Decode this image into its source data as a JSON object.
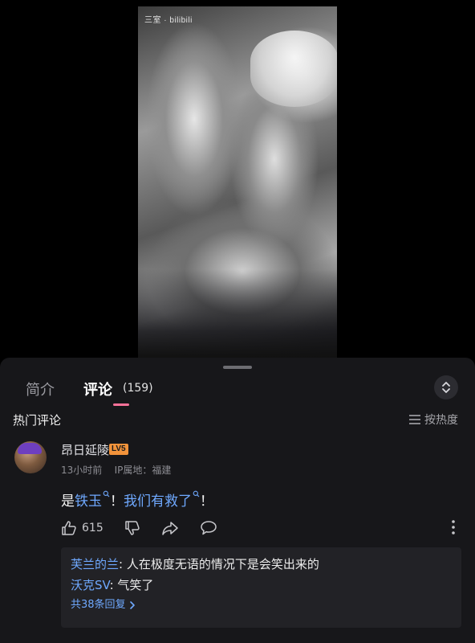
{
  "video": {
    "watermark": "三室 · bilibili"
  },
  "tabs": [
    {
      "label": "简介"
    },
    {
      "label": "评论",
      "count": "(159)",
      "active": true
    }
  ],
  "accent_color": "#fb7299",
  "link_color": "#6fa9ff",
  "section": {
    "title": "热门评论",
    "sort_label": "按热度"
  },
  "comment": {
    "username": "昂日延陵",
    "level": "LV5",
    "time": "13小时前",
    "location": "IP属地：福建",
    "text_before": "是",
    "link1": "铁玉",
    "text_mid": "！ ",
    "link2": "我们有救了",
    "text_after": "！",
    "likes": "615"
  },
  "replies": [
    {
      "user": "芙兰的兰",
      "text": "人在极度无语的情况下是会笑出来的"
    },
    {
      "user": "沃克SV",
      "text": "气笑了"
    }
  ],
  "reply_more": "共38条回复"
}
